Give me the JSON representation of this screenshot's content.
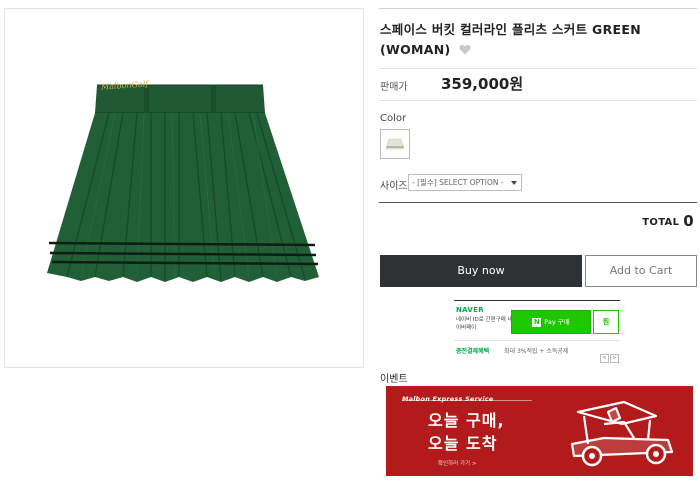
{
  "product": {
    "title": "스페이스 버킷 컬러라인 플리츠 스커트 GREEN (WOMAN)",
    "image_brand_text": "MalbonGolf",
    "price_label": "판매가",
    "price_value": "359,000원"
  },
  "options": {
    "color_label": "Color",
    "size_label": "사이즈",
    "size_select_value": "- [필수] SELECT OPTION -"
  },
  "total": {
    "label": "TOTAL",
    "value": "0"
  },
  "buttons": {
    "buy_now": "Buy now",
    "add_to_cart": "Add to Cart"
  },
  "naver_pay": {
    "logo": "NAVER",
    "desc": "네이버 ID로 간편구매 네이버페이",
    "pay_button": "Pay 구매",
    "wish_button": "찜",
    "benefit_label": "충전결제혜택",
    "benefit_text": "최대 3%적립 + 소득공제",
    "prev": "<",
    "next": ">"
  },
  "event": {
    "label": "이벤트",
    "banner_service": "Malbon Express Service",
    "banner_line1": "오늘 구매,",
    "banner_line2": "오늘 도착",
    "banner_link": "확인하러 가기 >"
  },
  "colors": {
    "skirt_green": "#1f5a35",
    "buy_button_bg": "#2e3235",
    "naver_green": "#1ec800",
    "banner_red": "#b21a1b"
  }
}
